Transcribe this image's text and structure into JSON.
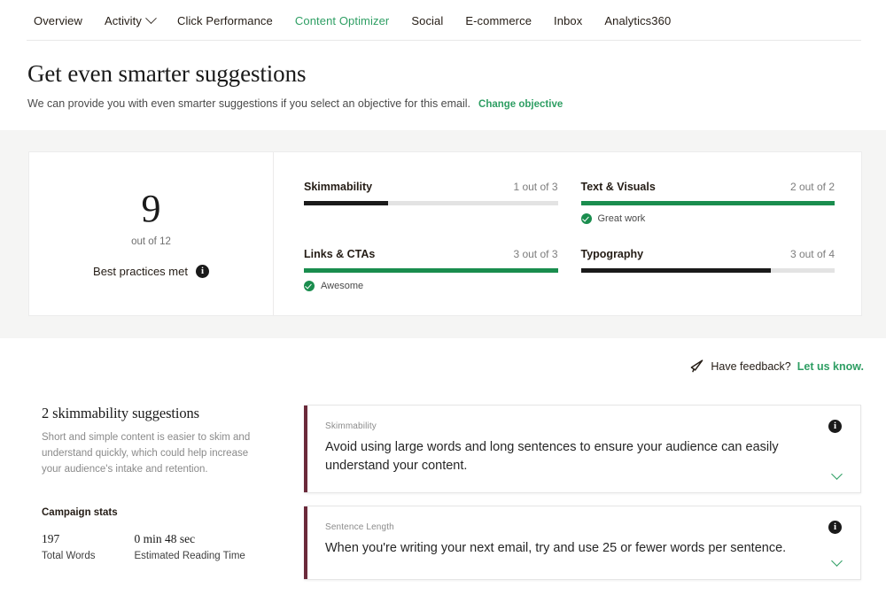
{
  "nav": {
    "items": [
      {
        "label": "Overview",
        "active": false,
        "has_caret": false
      },
      {
        "label": "Activity",
        "active": false,
        "has_caret": true
      },
      {
        "label": "Click Performance",
        "active": false,
        "has_caret": false
      },
      {
        "label": "Content Optimizer",
        "active": true,
        "has_caret": false
      },
      {
        "label": "Social",
        "active": false,
        "has_caret": false
      },
      {
        "label": "E-commerce",
        "active": false,
        "has_caret": false
      },
      {
        "label": "Inbox",
        "active": false,
        "has_caret": false
      },
      {
        "label": "Analytics360",
        "active": false,
        "has_caret": false
      }
    ]
  },
  "hero": {
    "title": "Get even smarter suggestions",
    "subtitle": "We can provide you with even smarter suggestions if you select an objective for this email.",
    "link": "Change objective"
  },
  "score": {
    "value": "9",
    "out_of": "out of 12",
    "label": "Best practices met",
    "info_icon": "info-icon"
  },
  "metrics": [
    {
      "name": "Skimmability",
      "count_label": "1 out of 3",
      "value": 1,
      "max": 3,
      "percent": 33,
      "color": "#1a1a1a",
      "note": ""
    },
    {
      "name": "Text & Visuals",
      "count_label": "2 out of 2",
      "value": 2,
      "max": 2,
      "percent": 100,
      "color": "#1a8d4e",
      "note": "Great work"
    },
    {
      "name": "Links & CTAs",
      "count_label": "3 out of 3",
      "value": 3,
      "max": 3,
      "percent": 100,
      "color": "#1a8d4e",
      "note": "Awesome"
    },
    {
      "name": "Typography",
      "count_label": "3 out of 4",
      "value": 3,
      "max": 4,
      "percent": 75,
      "color": "#1a1a1a",
      "note": ""
    }
  ],
  "feedback": {
    "icon": "megaphone-icon",
    "text": "Have feedback?",
    "link": "Let us know."
  },
  "suggestions_panel": {
    "title": "2 skimmability suggestions",
    "description": "Short and simple content is easier to skim and understand quickly, which could help increase your audience's intake and retention.",
    "stats_title": "Campaign stats",
    "stats": [
      {
        "value": "197",
        "label": "Total Words"
      },
      {
        "value": "0 min 48 sec",
        "label": "Estimated Reading Time"
      }
    ]
  },
  "suggestion_cards": [
    {
      "category": "Skimmability",
      "text": "Avoid using large words and long sentences to ensure your audience can easily understand your content.",
      "accent": "#6b2a3b"
    },
    {
      "category": "Sentence Length",
      "text": "When you're writing your next email, try and use 25 or fewer words per sentence.",
      "accent": "#6b2a3b"
    }
  ],
  "theme": {
    "green": "#2e9e63",
    "green_dark": "#1a8d4e",
    "maroon": "#6b2a3b",
    "band_bg": "#f5f5f4",
    "track": "#e3e3e3"
  }
}
